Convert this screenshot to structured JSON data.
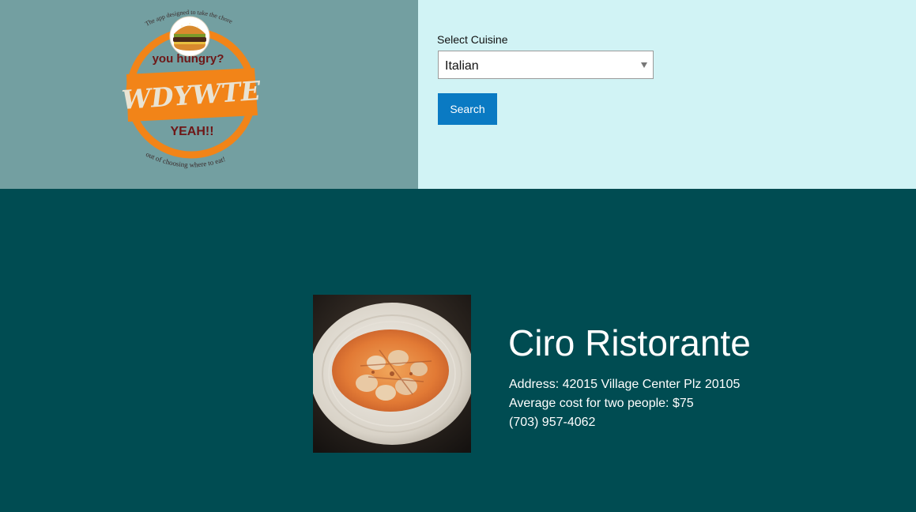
{
  "logo": {
    "top_arc_text": "The app designed to take the chore",
    "headline": "you hungry?",
    "banner": "WDYWTE",
    "tagline": "YEAH!!",
    "bottom_arc_text": "out of choosing where to eat!",
    "icon": "burger-icon"
  },
  "search": {
    "label": "Select Cuisine",
    "selected": "Italian",
    "button": "Search"
  },
  "restaurant": {
    "name": "Ciro Ristorante",
    "address": "Address: 42015 Village Center Plz 20105",
    "cost": "Average cost for two people: $75",
    "phone": "(703) 957-4062"
  },
  "colors": {
    "logo_panel": "#739fa1",
    "search_panel": "#d1f3f5",
    "results_bg": "#004c52",
    "button": "#0a7ac3",
    "logo_orange": "#f28418",
    "logo_maroon": "#6e1717"
  }
}
